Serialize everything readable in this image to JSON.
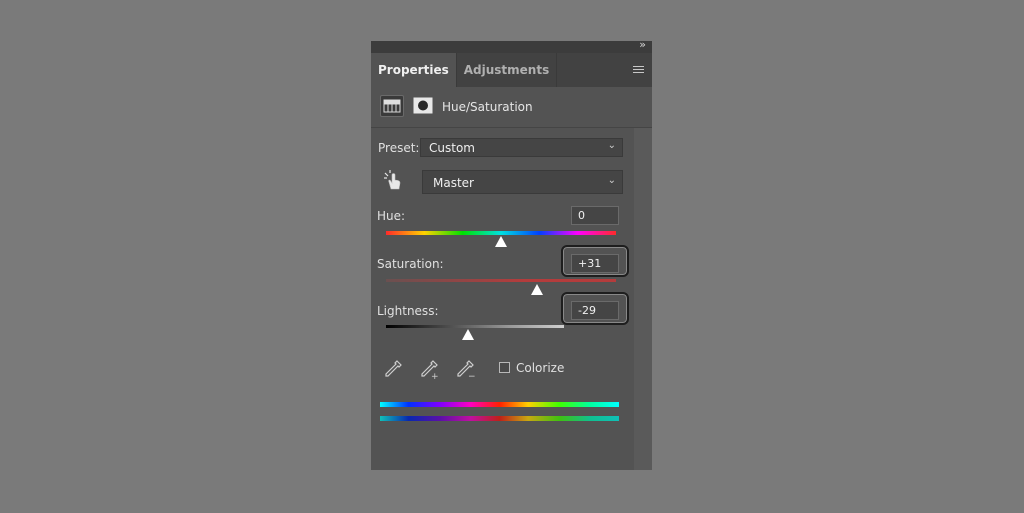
{
  "panel": {
    "collapse_glyph": "»",
    "tabs": [
      {
        "label": "Properties",
        "active": true
      },
      {
        "label": "Adjustments",
        "active": false
      }
    ],
    "menu_icon": "hamburger-menu-icon"
  },
  "header": {
    "title": "Hue/Saturation",
    "adjustment_icon": "hue-saturation-grid-icon",
    "mask_icon": "layer-mask-icon"
  },
  "preset": {
    "label": "Preset:",
    "value": "Custom"
  },
  "channel": {
    "value": "Master",
    "tool_icon": "targeted-adjustment-hand-icon"
  },
  "hue": {
    "label": "Hue:",
    "value": "0",
    "slider_fraction": 0.5
  },
  "saturation": {
    "label": "Saturation:",
    "value": "+31",
    "slider_fraction": 0.655,
    "highlighted": true
  },
  "lightness": {
    "label": "Lightness:",
    "value": "-29",
    "slider_fraction": 0.355,
    "highlighted": true
  },
  "tools": {
    "eyedropper_icons": [
      "eyedropper-icon",
      "eyedropper-add-icon",
      "eyedropper-subtract-icon"
    ],
    "colorize_label": "Colorize",
    "colorize_checked": false
  },
  "colors": {
    "panel_bg": "#535353",
    "page_bg": "#7a7a7a",
    "saturation_track": "#b43c3c",
    "highlight_border": "#1e1e1e"
  }
}
